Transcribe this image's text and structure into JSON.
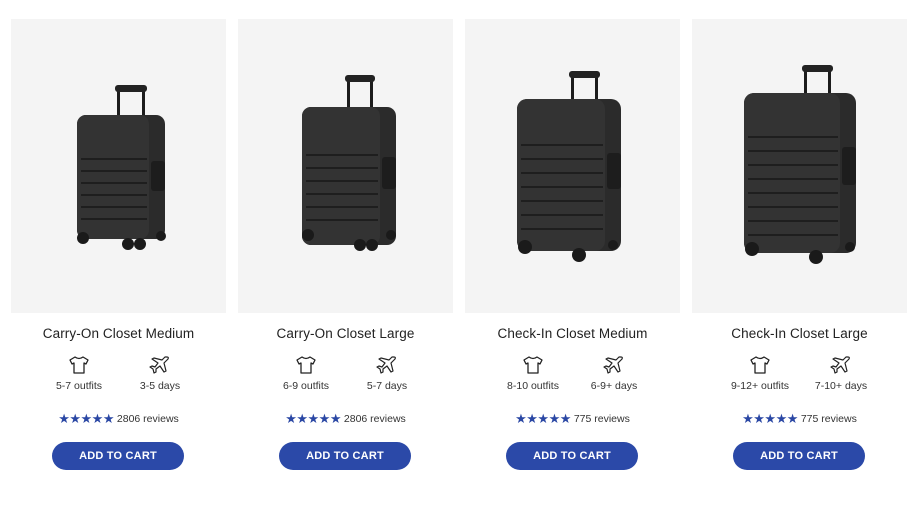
{
  "colors": {
    "accent": "#2b49a8",
    "star": "#2a47a4",
    "image_bg": "#f4f4f4"
  },
  "icons": {
    "outfits": "tshirt-icon",
    "days": "airplane-icon",
    "rating": "star-icon"
  },
  "products": [
    {
      "title": "Carry-On Closet Medium",
      "outfits": "5-7 outfits",
      "days": "3-5 days",
      "stars": "★★★★★",
      "reviews": "2806 reviews",
      "cta": "ADD TO CART"
    },
    {
      "title": "Carry-On Closet Large",
      "outfits": "6-9 outfits",
      "days": "5-7 days",
      "stars": "★★★★★",
      "reviews": "2806 reviews",
      "cta": "ADD TO CART"
    },
    {
      "title": "Check-In Closet Medium",
      "outfits": "8-10 outfits",
      "days": "6-9+ days",
      "stars": "★★★★★",
      "reviews": "775 reviews",
      "cta": "ADD TO CART"
    },
    {
      "title": "Check-In Closet Large",
      "outfits": "9-12+ outfits",
      "days": "7-10+ days",
      "stars": "★★★★★",
      "reviews": "775 reviews",
      "cta": "ADD TO CART"
    }
  ]
}
